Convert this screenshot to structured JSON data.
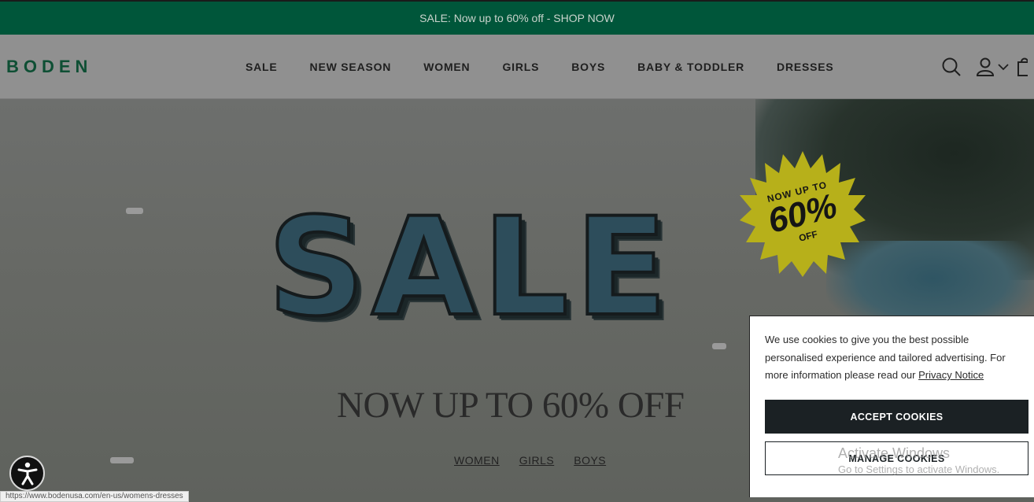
{
  "promo": {
    "text": "SALE: Now up to 60% off - SHOP NOW"
  },
  "header": {
    "logo": "BODEN",
    "nav": [
      "SALE",
      "NEW SEASON",
      "WOMEN",
      "GIRLS",
      "BOYS",
      "BABY & TODDLER",
      "DRESSES"
    ],
    "icons": [
      "search-icon",
      "account-icon",
      "chevron-down-icon",
      "bag-icon"
    ]
  },
  "hero": {
    "headline": "SALE",
    "badge": {
      "top": "NOW UP TO",
      "big": "60%",
      "off": "OFF"
    },
    "subtitle": "NOW UP TO 60% OFF",
    "links": [
      "WOMEN",
      "GIRLS",
      "BOYS"
    ]
  },
  "cookie": {
    "text": "We use cookies to give you the best possible personalised experience and tailored advertising. For more information please read our ",
    "link": "Privacy Notice",
    "accept": "ACCEPT COOKIES",
    "manage": "MANAGE COOKIES"
  },
  "status_url": "https://www.bodenusa.com/en-us/womens-dresses",
  "watermark": {
    "title": "Activate Windows",
    "sub": "Go to Settings to activate Windows."
  },
  "colors": {
    "promo_bg": "#00563a",
    "logo": "#0e4f34",
    "badge": "#b7b01a",
    "accept_bg": "#1b2124"
  }
}
